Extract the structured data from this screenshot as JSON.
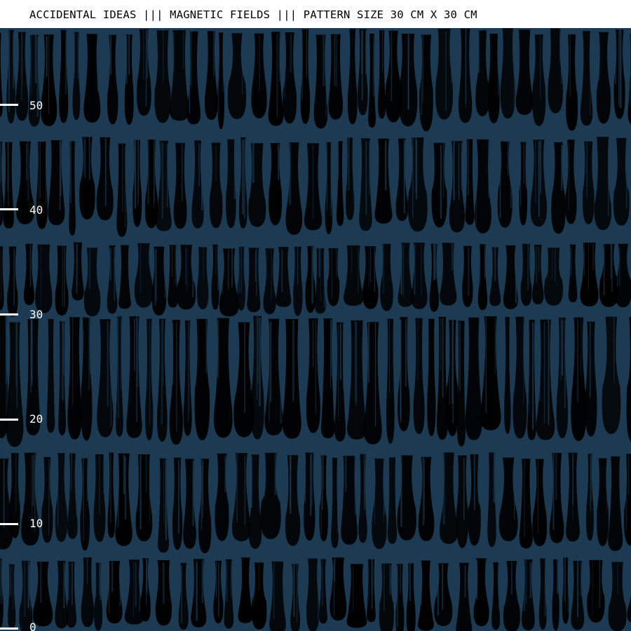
{
  "header": {
    "title": "ACCIDENTAL IDEAS ||| MAGNETIC FIELDS ||| PATTERN SIZE 30 CM X 30 CM"
  },
  "pattern": {
    "background_color": "#1c3a52",
    "stroke_color": "#000000"
  },
  "ruler": {
    "tick_color": "#ffffff",
    "labels": [
      "50",
      "40",
      "30",
      "20",
      "10",
      "0"
    ]
  }
}
